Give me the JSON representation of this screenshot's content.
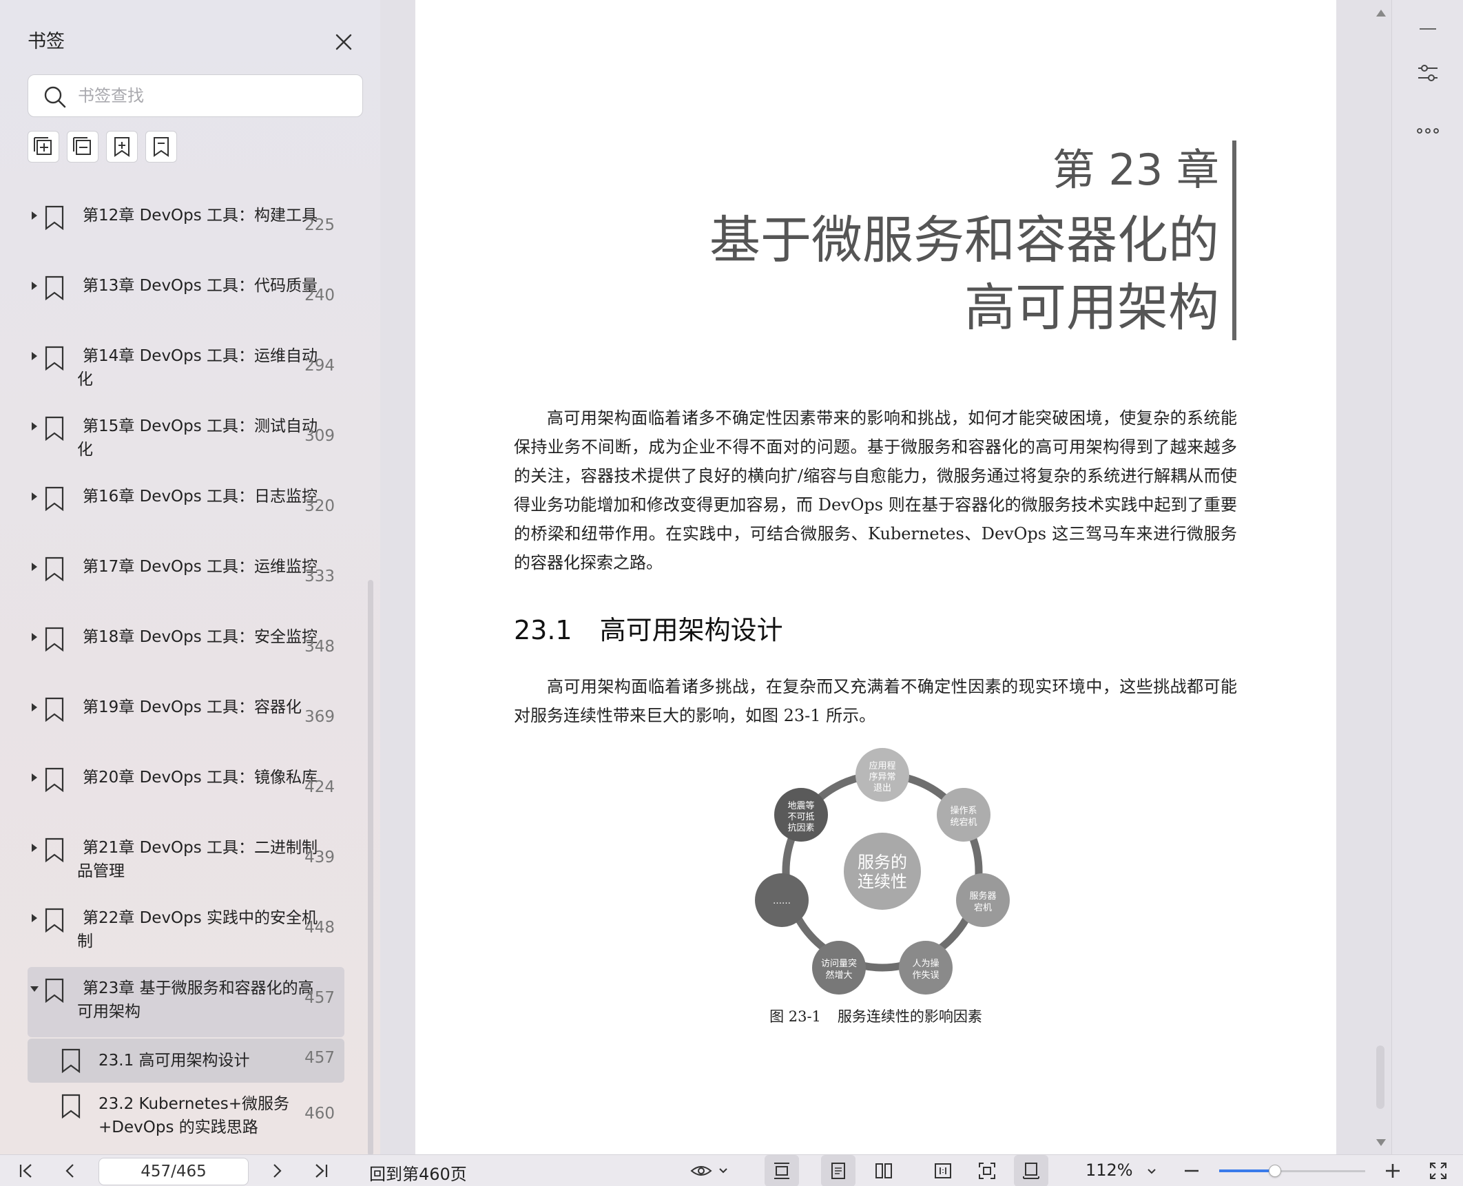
{
  "sidebar": {
    "title": "书签",
    "search_placeholder": "书签查找",
    "bookmarks": [
      {
        "label": "第12章 DevOps 工具：构建工具",
        "page": "225"
      },
      {
        "label": "第13章 DevOps 工具：代码质量",
        "page": "240"
      },
      {
        "label": "第14章 DevOps 工具：运维自动化",
        "page": "294"
      },
      {
        "label": "第15章 DevOps 工具：测试自动化",
        "page": "309"
      },
      {
        "label": "第16章 DevOps 工具：日志监控",
        "page": "320"
      },
      {
        "label": "第17章 DevOps 工具：运维监控",
        "page": "333"
      },
      {
        "label": "第18章 DevOps 工具：安全监控",
        "page": "348"
      },
      {
        "label": "第19章 DevOps 工具：容器化",
        "page": "369"
      },
      {
        "label": "第20章 DevOps 工具：镜像私库",
        "page": "424"
      },
      {
        "label": "第21章 DevOps 工具：二进制制品管理",
        "page": "439"
      },
      {
        "label": "第22章 DevOps 实践中的安全机制",
        "page": "448"
      },
      {
        "label": "第23章 基于微服务和容器化的高可用架构",
        "page": "457"
      }
    ],
    "sub_bookmarks": [
      {
        "label": "23.1 高可用架构设计",
        "page": "457"
      },
      {
        "label": "23.2 Kubernetes+微服务+DevOps 的实践思路",
        "page": "460"
      }
    ]
  },
  "document": {
    "chapter_number": "第 23 章",
    "chapter_title_line1": "基于微服务和容器化的",
    "chapter_title_line2": "高可用架构",
    "paragraph1": "高可用架构面临着诸多不确定性因素带来的影响和挑战，如何才能突破困境，使复杂的系统能保持业务不间断，成为企业不得不面对的问题。基于微服务和容器化的高可用架构得到了越来越多的关注，容器技术提供了良好的横向扩/缩容与自愈能力，微服务通过将复杂的系统进行解耦从而使得业务功能增加和修改变得更加容易，而 DevOps 则在基于容器化的微服务技术实践中起到了重要的桥梁和纽带作用。在实践中，可结合微服务、Kubernetes、DevOps 这三驾马车来进行微服务的容器化探索之路。",
    "section_number": "23.1",
    "section_title": "高可用架构设计",
    "paragraph2": "高可用架构面临着诸多挑战，在复杂而又充满着不确定性因素的现实环境中，这些挑战都可能对服务连续性带来巨大的影响，如图 23-1 所示。",
    "figure": {
      "center_line1": "服务的",
      "center_line2": "连续性",
      "nodes": [
        {
          "line1": "应用程",
          "line2": "序异常",
          "line3": "退出"
        },
        {
          "line1": "操作系",
          "line2": "统宕机",
          "line3": ""
        },
        {
          "line1": "服务器",
          "line2": "宕机",
          "line3": ""
        },
        {
          "line1": "人为操",
          "line2": "作失误",
          "line3": ""
        },
        {
          "line1": "访问量突",
          "line2": "然增大",
          "line3": ""
        },
        {
          "line1": "……",
          "line2": "",
          "line3": ""
        },
        {
          "line1": "地震等",
          "line2": "不可抵",
          "line3": "抗因素"
        }
      ],
      "caption_number": "图 23-1",
      "caption_text": "服务连续性的影响因素"
    }
  },
  "bottom_bar": {
    "page_indicator": "457/465",
    "goto_text": "回到第460页",
    "zoom": "112%",
    "zoom_slider_fraction": 0.38
  }
}
